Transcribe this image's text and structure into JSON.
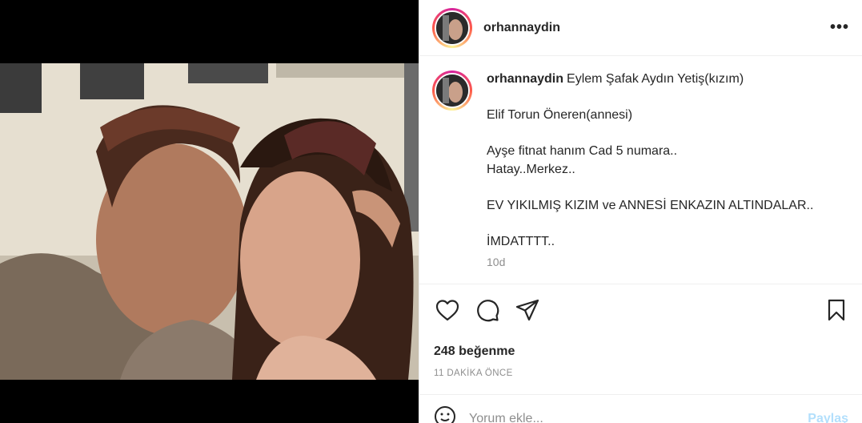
{
  "post": {
    "username": "orhannaydin",
    "more_label": "•••",
    "caption_lines": [
      "Eylem Şafak Aydın Yetiş(kızım)",
      "",
      "Elif Torun Öneren(annesi)",
      "",
      "Ayşe fitnat hanım Cad 5 numara..",
      "Hatay..Merkez..",
      "",
      "EV YIKILMIŞ KIZIM ve ANNESİ ENKAZIN ALTINDALAR..",
      "",
      "İMDATTTT.."
    ],
    "caption_age": "10d",
    "likes": "248 beğenme",
    "posted_time": "11 DAKİKA ÖNCE"
  },
  "comment_input": {
    "placeholder": "Yorum ekle...",
    "post_label": "Paylaş"
  },
  "icons": [
    "heart-icon",
    "comment-icon",
    "share-icon",
    "bookmark-icon",
    "emoji-icon",
    "more-options-icon"
  ],
  "colors": {
    "link_disabled": "#b2dffc",
    "muted_text": "#8e8e8e",
    "primary_text": "#262626"
  }
}
